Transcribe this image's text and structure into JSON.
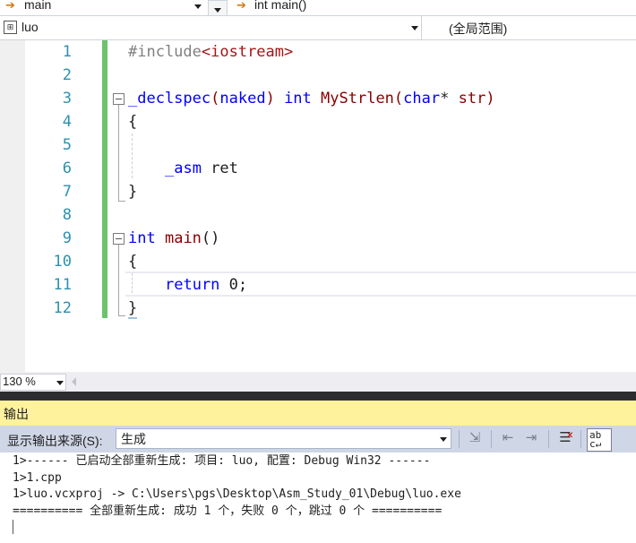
{
  "nav": {
    "function_dropdown": "main",
    "member_dropdown": "int main()"
  },
  "scope": {
    "project": "luo",
    "range": "(全局范围)"
  },
  "editor": {
    "line_numbers": [
      "1",
      "2",
      "3",
      "4",
      "5",
      "6",
      "7",
      "8",
      "9",
      "10",
      "11",
      "12"
    ],
    "code": {
      "l1_pp": "#include",
      "l1_str": "<iostream>",
      "l3_kw1": "_declspec",
      "l3_p1": "(",
      "l3_kw2": "naked",
      "l3_p2": ")",
      "l3_kw3": "int",
      "l3_fn": "MyStrlen",
      "l3_p3": "(",
      "l3_kw4": "char",
      "l3_p4": "* ",
      "l3_param": "str",
      "l3_p5": ")",
      "l4": "{",
      "l6_kw": "_asm",
      "l6_rest": " ret",
      "l7": "}",
      "l9_kw": "int",
      "l9_fn": "main",
      "l9_rest": "()",
      "l10": "{",
      "l11_kw": "return",
      "l11_rest": " 0;",
      "l12": "}"
    }
  },
  "zoom": {
    "level": "130 %"
  },
  "output": {
    "title": "输出",
    "source_label": "显示输出来源(S):",
    "source_value": "生成",
    "lines": [
      "1>------ 已启动全部重新生成: 项目: luo, 配置: Debug Win32 ------",
      "1>1.cpp",
      "1>luo.vcxproj -> C:\\Users\\pgs\\Desktop\\Asm_Study_01\\Debug\\luo.exe",
      "========== 全部重新生成: 成功 1 个，失败 0 个，跳过 0 个 =========="
    ]
  },
  "colors": {
    "keyword": "#0000ff",
    "function": "#880000",
    "string": "#a31515",
    "preprocessor": "#808080",
    "line_number": "#2b91af",
    "change_bar": "#6cc36c",
    "output_title_bg": "#fff29d"
  }
}
